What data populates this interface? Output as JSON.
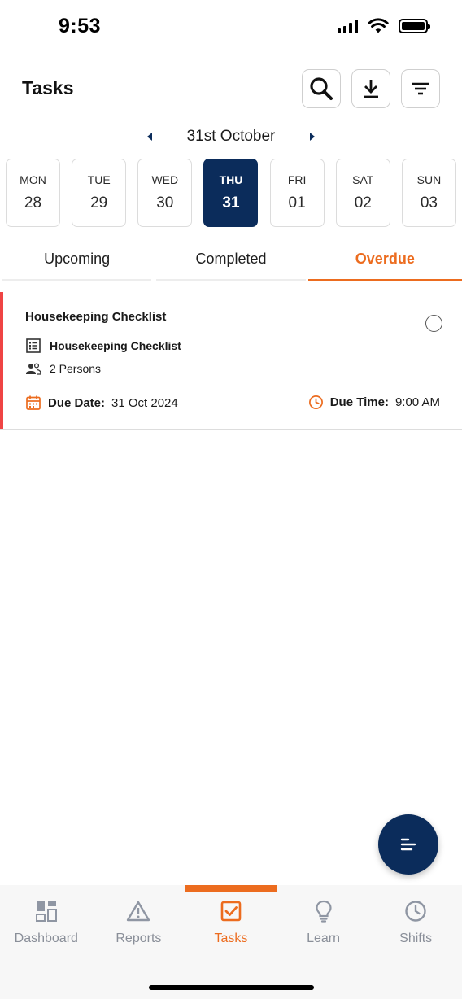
{
  "status_bar": {
    "time": "9:53"
  },
  "header": {
    "title": "Tasks"
  },
  "date_nav": {
    "month_label": "31st October"
  },
  "days": [
    {
      "name": "MON",
      "num": "28",
      "selected": false
    },
    {
      "name": "TUE",
      "num": "29",
      "selected": false
    },
    {
      "name": "WED",
      "num": "30",
      "selected": false
    },
    {
      "name": "THU",
      "num": "31",
      "selected": true
    },
    {
      "name": "FRI",
      "num": "01",
      "selected": false
    },
    {
      "name": "SAT",
      "num": "02",
      "selected": false
    },
    {
      "name": "SUN",
      "num": "03",
      "selected": false
    }
  ],
  "tabs": [
    {
      "label": "Upcoming",
      "active": false
    },
    {
      "label": "Completed",
      "active": false
    },
    {
      "label": "Overdue",
      "active": true
    }
  ],
  "task": {
    "title": "Housekeeping Checklist",
    "checklist": "Housekeeping Checklist",
    "persons": "2 Persons",
    "due_date_label": "Due Date:",
    "due_date": "31 Oct 2024",
    "due_time_label": "Due Time:",
    "due_time": "9:00 AM",
    "status_color": "#ef4444"
  },
  "bottom_nav": [
    {
      "label": "Dashboard",
      "icon": "dashboard-icon",
      "active": false
    },
    {
      "label": "Reports",
      "icon": "warning-icon",
      "active": false
    },
    {
      "label": "Tasks",
      "icon": "checkbox-icon",
      "active": true
    },
    {
      "label": "Learn",
      "icon": "lightbulb-icon",
      "active": false
    },
    {
      "label": "Shifts",
      "icon": "clock-icon",
      "active": false
    }
  ],
  "colors": {
    "primary": "#0b2c5b",
    "accent": "#ec6c1f",
    "overdue": "#ef4444"
  }
}
